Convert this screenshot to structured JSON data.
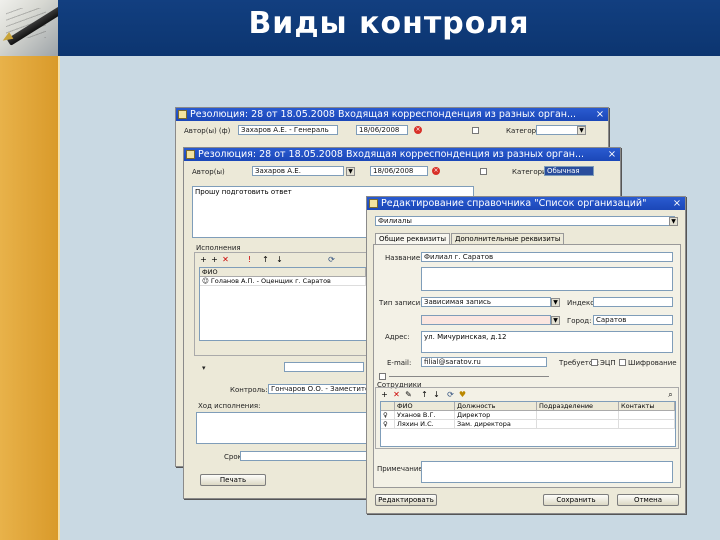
{
  "slide": {
    "title": "Виды контроля",
    "colors": {
      "header_bg": "#123f80",
      "stripe": "#e8b24a",
      "titlebar": "#2a5bd0",
      "window_bg": "#ece9d8",
      "background": "#c9d9e3"
    }
  },
  "win1": {
    "title": "Резолюция: 28 от 18.05.2008 Входящая корреспонденция из разных орган...",
    "author_label": "Автор(ы) (ф)",
    "author_value": "Захаров А.Е. - Генераль",
    "date_value": "18/06/2008",
    "category_label": "Категория"
  },
  "win2": {
    "title": "Резолюция: 28 от 18.05.2008 Входящая корреспонденция из разных орган...",
    "author_label": "Автор(ы)",
    "author_value": "Захаров А.Е.",
    "date_value": "18/06/2008",
    "category_label": "Категория",
    "category_value": "Обычная",
    "resolution_text": "Прошу подготовить ответ",
    "executors_label": "Исполнения",
    "executors_header": "ФИО",
    "executors_row": "Голанов А.П. - Оценщик г. Саратов",
    "controller_label": "Контроль:",
    "controller_value": "Гончаров О.О. - Заместитель ген.",
    "progress_label": "Ход исполнения:",
    "deadline_label": "Срок:",
    "print_button": "Печать"
  },
  "win3": {
    "title": "Редактирование справочника \"Список организаций\"",
    "record_value": "Филиалы",
    "tabs": [
      "Общие реквизиты",
      "Дополнительные реквизиты"
    ],
    "name_label": "Название:",
    "name_value": "Филиал г. Саратов",
    "type_label": "Тип записи:",
    "type_value": "Зависимая запись",
    "index_label": "Индекс:",
    "city_label": "Город:",
    "city_value": "Саратов",
    "address_label": "Адрес:",
    "address_value": "ул. Мичуринская, д.12",
    "email_label": "E-mail:",
    "email_value": "filial@saratov.ru",
    "requires_label": "Требуется:",
    "opt_edo": "ЭЦП",
    "opt_shifr": "Шифрование",
    "employees_label": "Сотрудники",
    "employees_cols": [
      "ФИО",
      "Должность",
      "Подразделение",
      "Контакты"
    ],
    "employees": [
      {
        "fio": "Уханов В.Г.",
        "position": "Директор"
      },
      {
        "fio": "Ляхин И.С.",
        "position": "Зам. директора"
      }
    ],
    "notes_label": "Примечание:",
    "edit_button": "Редактировать",
    "save_button": "Сохранить",
    "cancel_button": "Отмена"
  }
}
